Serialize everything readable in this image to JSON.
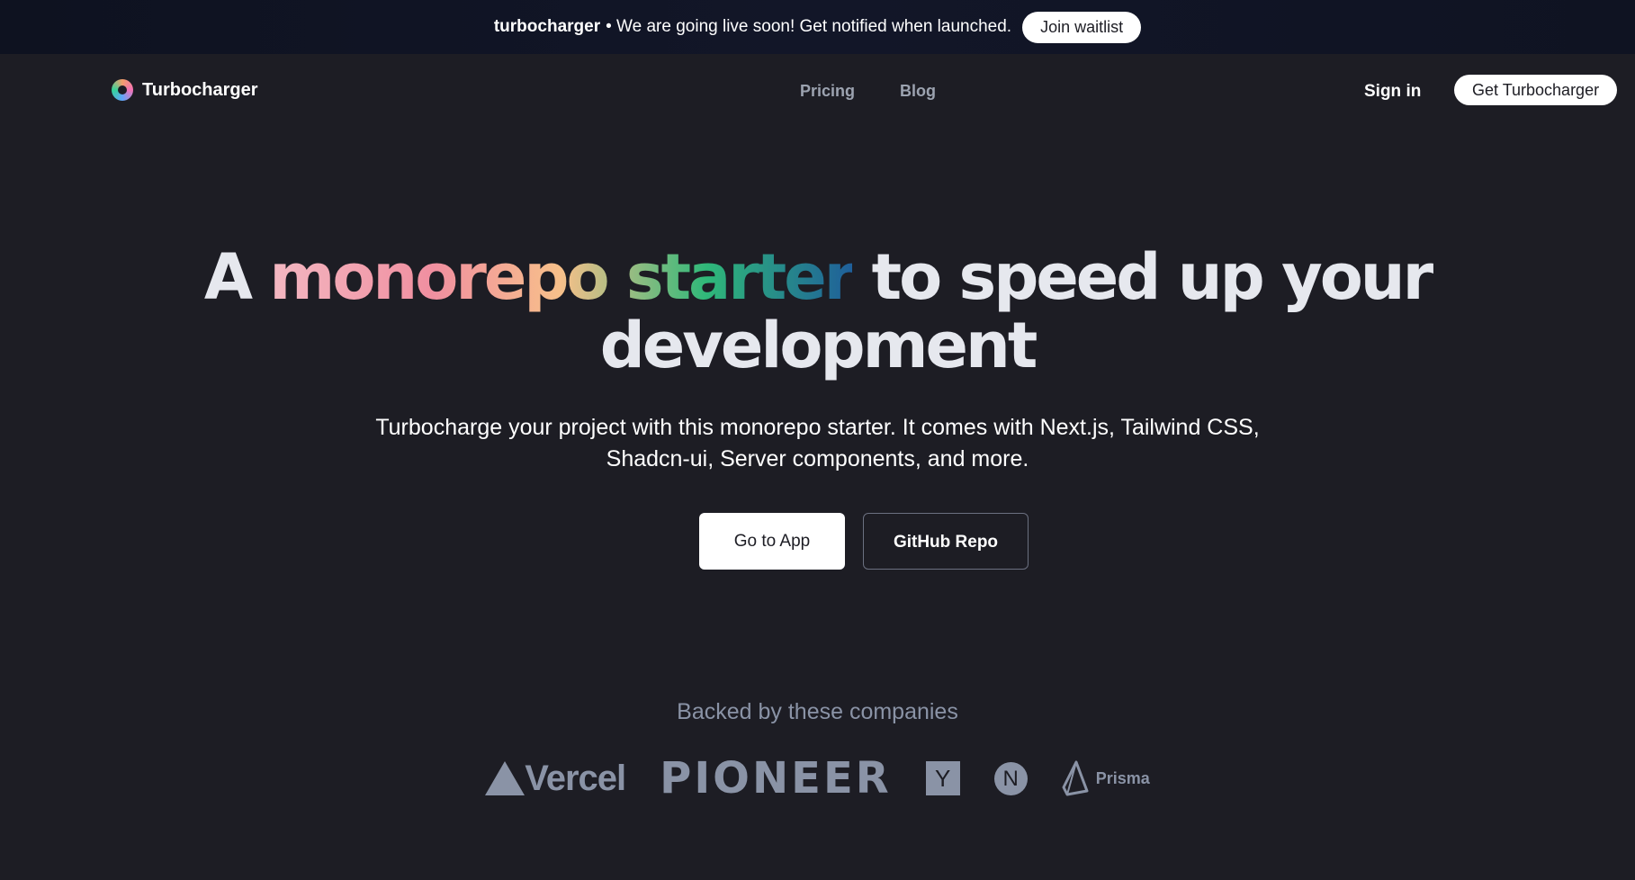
{
  "banner": {
    "brand": "turbocharger",
    "message": "• We are going live soon! Get notified when launched.",
    "button": "Join waitlist"
  },
  "nav": {
    "logo_text": "Turbocharger",
    "links": [
      "Pricing",
      "Blog"
    ],
    "signin": "Sign in",
    "cta": "Get Turbocharger"
  },
  "hero": {
    "title_part1": "A ",
    "title_highlight": "monorepo starter",
    "title_part2": " to speed up your development",
    "subtitle": "Turbocharge your project with this monorepo starter. It comes with Next.js, Tailwind CSS, Shadcn-ui, Server components, and more.",
    "primary_button": "Go to App",
    "secondary_button": "GitHub Repo"
  },
  "backers": {
    "heading": "Backed by these companies",
    "vercel": "Vercel",
    "pioneer": "PIONEER",
    "yc": "Y",
    "next": "N",
    "prisma": "Prisma"
  },
  "colors": {
    "background": "#1d1d24",
    "banner": "#0e1220",
    "muted": "#8a93a6"
  }
}
